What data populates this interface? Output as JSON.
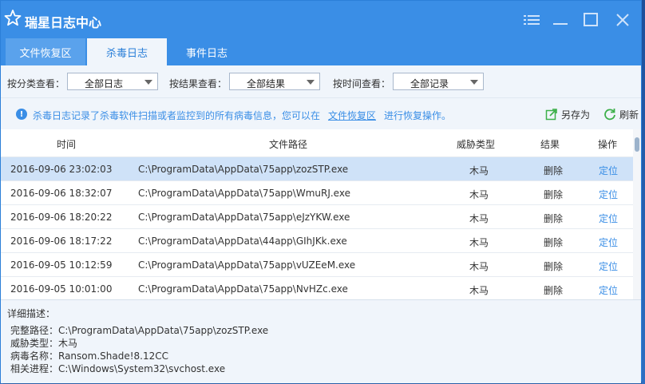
{
  "window": {
    "title": "瑞星日志中心"
  },
  "tabs": [
    {
      "label": "文件恢复区"
    },
    {
      "label": "杀毒日志"
    },
    {
      "label": "事件日志"
    }
  ],
  "filters": {
    "category_label": "按分类查看：",
    "category_value": "全部日志",
    "result_label": "按结果查看：",
    "result_value": "全部结果",
    "time_label": "按时间查看：",
    "time_value": "全部记录"
  },
  "info": {
    "text": "杀毒日志记录了杀毒软件扫描或者监控到的所有病毒信息，您可以在",
    "link": "文件恢复区",
    "tail": "进行恢复操作。"
  },
  "actions": {
    "save_as": "另存为",
    "refresh": "刷新"
  },
  "table": {
    "headers": {
      "time": "时间",
      "path": "文件路径",
      "threat": "威胁类型",
      "result": "结果",
      "op": "操作"
    },
    "rows": [
      {
        "time": "2016-09-06 23:02:03",
        "path": "C:\\ProgramData\\AppData\\75app\\zozSTP.exe",
        "threat": "木马",
        "result": "删除",
        "op": "定位"
      },
      {
        "time": "2016-09-06 18:32:07",
        "path": "C:\\ProgramData\\AppData\\75app\\WmuRJ.exe",
        "threat": "木马",
        "result": "删除",
        "op": "定位"
      },
      {
        "time": "2016-09-06 18:20:22",
        "path": "C:\\ProgramData\\AppData\\75app\\eJzYKW.exe",
        "threat": "木马",
        "result": "删除",
        "op": "定位"
      },
      {
        "time": "2016-09-06 18:17:22",
        "path": "C:\\ProgramData\\AppData\\44app\\GIhJKk.exe",
        "threat": "木马",
        "result": "删除",
        "op": "定位"
      },
      {
        "time": "2016-09-05 10:12:59",
        "path": "C:\\ProgramData\\AppData\\75app\\vUZEeM.exe",
        "threat": "木马",
        "result": "删除",
        "op": "定位"
      },
      {
        "time": "2016-09-05 10:01:00",
        "path": "C:\\ProgramData\\AppData\\75app\\NvHZc.exe",
        "threat": "木马",
        "result": "删除",
        "op": "定位"
      }
    ]
  },
  "detail": {
    "title": "详细描述：",
    "lines": [
      "完整路径：C:\\ProgramData\\AppData\\75app\\zozSTP.exe",
      "威胁类型：木马",
      "病毒名称：Ransom.Shade!8.12CC",
      "相关进程：C:\\Windows\\System32\\svchost.exe"
    ]
  },
  "colors": {
    "accent": "#3a8ee6",
    "selected_row": "#cfe2f8",
    "panel": "#f0f5fb"
  }
}
